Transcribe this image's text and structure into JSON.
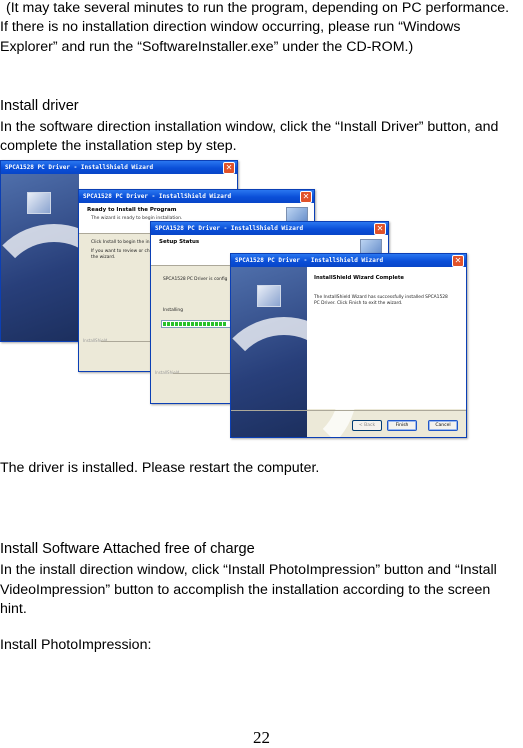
{
  "page": {
    "intro_line1": "(It may take several minutes to run the program, depending on PC performance.",
    "intro_line2": "If there is no installation direction window occurring, please run “Windows",
    "intro_line3": "Explorer” and run the “SoftwareInstaller.exe” under the CD-ROM.)",
    "install_driver_heading": "Install driver",
    "install_driver_line1": "In the software direction installation window, click the “Install Driver” button, and",
    "install_driver_line2": "complete the installation step by step.",
    "driver_installed": "The driver is installed. Please restart the computer.",
    "software_heading": "Install Software Attached free of charge",
    "software_line1": "In the install direction window, click “Install PhotoImpression” button and “Install",
    "software_line2": "VideoImpression” button to accomplish the installation according to the screen",
    "software_line3": "hint.",
    "photoimpression_label": "Install PhotoImpression:",
    "page_number": "22"
  },
  "screenshots": {
    "window_title": "SPCA1528 PC Driver - InstallShield Wizard",
    "close_glyph": "✕",
    "installshield_label": "InstallShield",
    "win2": {
      "header_title": "Ready to Install the Program",
      "header_sub": "The wizard is ready to begin installation.",
      "body1": "Click Install to begin the in",
      "body2": "If you want to review or ch",
      "body3": "the wizard."
    },
    "win3": {
      "header_title": "Setup Status",
      "body1": "SPCA1528 PC Driver is config",
      "body2": "Installing"
    },
    "win4": {
      "title": "InstallShield Wizard Complete",
      "body1": "The InstallShield Wizard has successfully installed SPCA1528",
      "body2": "PC Driver.  Click Finish to exit the wizard.",
      "back_button": "< Back",
      "finish_button": "Finish",
      "cancel_button": "Cancel"
    }
  }
}
